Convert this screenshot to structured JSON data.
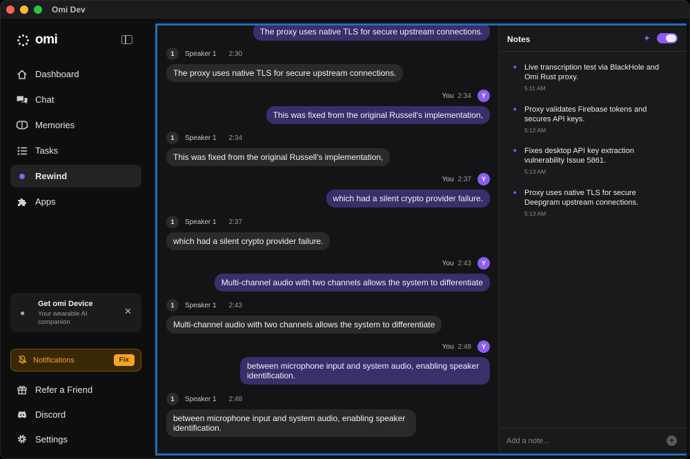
{
  "window": {
    "title": "Omi Dev"
  },
  "brand": {
    "name": "omi"
  },
  "sidebar": {
    "items": [
      {
        "label": "Dashboard",
        "icon": "home-icon"
      },
      {
        "label": "Chat",
        "icon": "chat-icon"
      },
      {
        "label": "Memories",
        "icon": "brain-icon"
      },
      {
        "label": "Tasks",
        "icon": "tasks-icon"
      },
      {
        "label": "Rewind",
        "icon": "rewind-dot-icon"
      },
      {
        "label": "Apps",
        "icon": "puzzle-icon"
      }
    ],
    "active_item": "Rewind",
    "promo": {
      "title": "Get omi Device",
      "subtitle": "Your wearable AI companion"
    },
    "notification": {
      "label": "Notifications",
      "action": "Fix"
    },
    "bottom_items": [
      {
        "label": "Refer a Friend",
        "icon": "gift-icon"
      },
      {
        "label": "Discord",
        "icon": "discord-icon"
      },
      {
        "label": "Settings",
        "icon": "gear-icon"
      }
    ]
  },
  "transcript": {
    "you_label": "You",
    "you_avatar": "Y",
    "speaker_avatar": "1",
    "messages": [
      {
        "from": "you",
        "time": "",
        "text": "The proxy uses native TLS for secure upstream connections."
      },
      {
        "from": "speaker",
        "speaker": "Speaker 1",
        "time": "2:30",
        "text": "The proxy uses native TLS for secure upstream connections."
      },
      {
        "from": "you",
        "time": "2:34",
        "text": "This was fixed from the original Russell's implementation,"
      },
      {
        "from": "speaker",
        "speaker": "Speaker 1",
        "time": "2:34",
        "text": "This was fixed from the original Russell's implementation,"
      },
      {
        "from": "you",
        "time": "2:37",
        "text": "which had a silent crypto provider failure."
      },
      {
        "from": "speaker",
        "speaker": "Speaker 1",
        "time": "2:37",
        "text": "which had a silent crypto provider failure."
      },
      {
        "from": "you",
        "time": "2:43",
        "text": "Multi-channel audio with two channels allows the system to differentiate"
      },
      {
        "from": "speaker",
        "speaker": "Speaker 1",
        "time": "2:43",
        "text": "Multi-channel audio with two channels allows the system to differentiate"
      },
      {
        "from": "you",
        "time": "2:48",
        "text": "between microphone input and system audio, enabling speaker identification."
      },
      {
        "from": "speaker",
        "speaker": "Speaker 1",
        "time": "2:48",
        "text": "between microphone input and system audio, enabling speaker identification."
      }
    ]
  },
  "notes": {
    "title": "Notes",
    "toggle_on": true,
    "items": [
      {
        "text": "Live transcription test via BlackHole and Omi Rust proxy.",
        "time": "5:11 AM"
      },
      {
        "text": "Proxy validates Firebase tokens and secures API keys.",
        "time": "5:12 AM"
      },
      {
        "text": "Fixes desktop API key extraction vulnerability Issue 5861.",
        "time": "5:13 AM"
      },
      {
        "text": "Proxy uses native TLS for secure Deepgram upstream connections.",
        "time": "5:13 AM"
      }
    ],
    "input_placeholder": "Add a note..."
  },
  "colors": {
    "accent": "#8b5cf6",
    "focus_frame": "#1d6fc2",
    "notification": "#f5a623",
    "bubble_you": "#3a2e6b",
    "bubble_speaker": "#2a2a2c"
  }
}
